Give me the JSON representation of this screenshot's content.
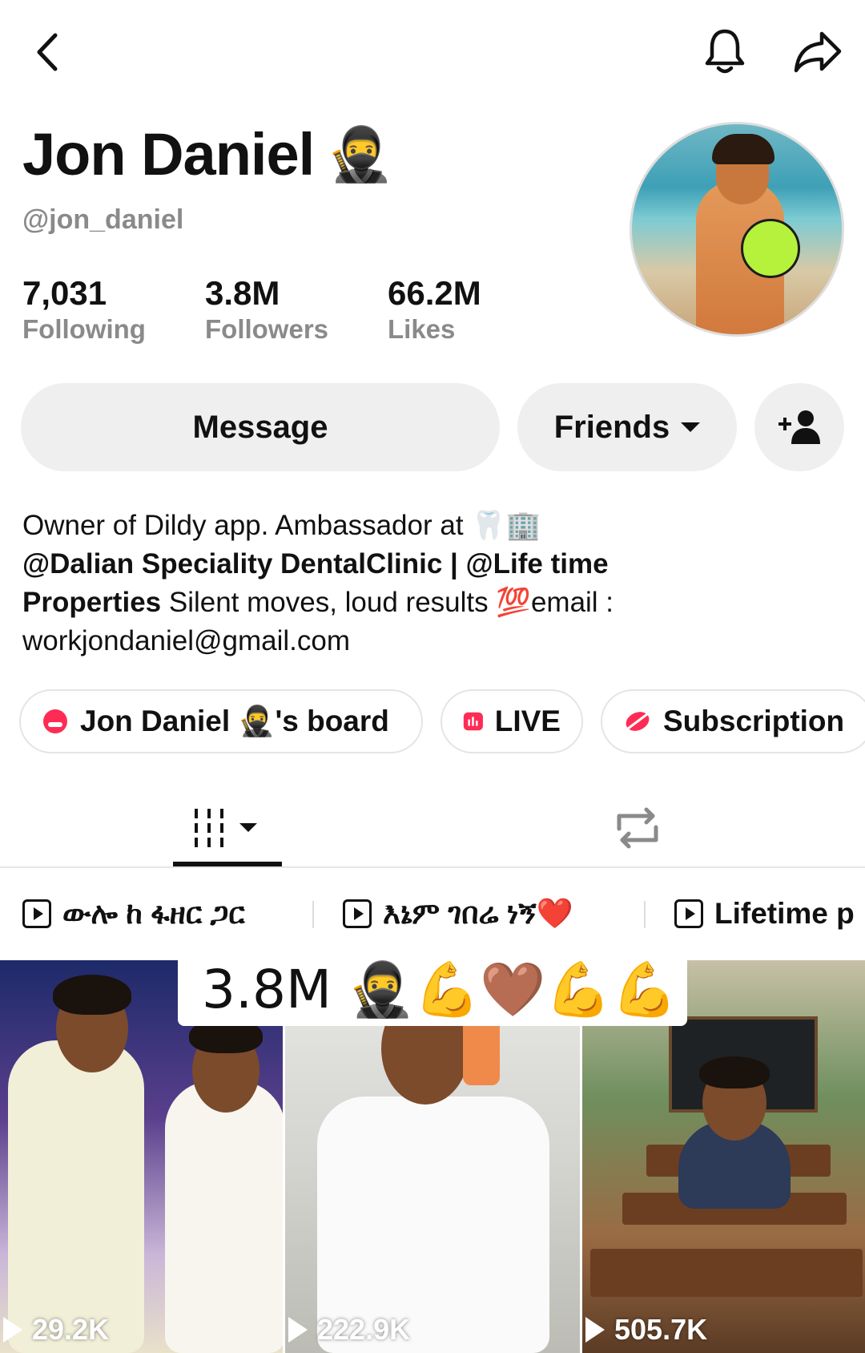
{
  "header": {
    "back_label": "Back",
    "bell_label": "Notifications",
    "share_label": "Share"
  },
  "profile": {
    "name": "Jon Daniel",
    "name_emoji": "🥷",
    "handle": "@jon_daniel",
    "stats": [
      {
        "value": "7,031",
        "label": "Following"
      },
      {
        "value": "3.8M",
        "label": "Followers"
      },
      {
        "value": "66.2M",
        "label": "Likes"
      }
    ]
  },
  "actions": {
    "message_label": "Message",
    "friends_label": "Friends"
  },
  "bio": {
    "line1": "Owner of Dildy app.   Ambassador at 🦷🏢",
    "line2": "@Dalian Speciality DentalClinic  | @Life time",
    "line3_bold": "Properties",
    "line3_rest": "  Silent moves, loud results 💯email :",
    "line4": "workjondaniel@gmail.com"
  },
  "chips": {
    "board": "Jon Daniel 🥷's board",
    "live": "LIVE",
    "subscription": "Subscription"
  },
  "playlists": [
    "ውሎ ከ ፋዘር ጋር",
    "እኔም ገበሬ ነኝ❤️",
    "Lifetime p"
  ],
  "overlay": {
    "text": "3.8M 🥷💪🤎💪💪"
  },
  "videos": [
    {
      "views": "29.2K"
    },
    {
      "views": "222.9K"
    },
    {
      "views": "505.7K"
    }
  ],
  "colors": {
    "accent_pink": "#fe2c55",
    "muted_text": "#8a8a8a",
    "button_bg": "#efefef"
  }
}
